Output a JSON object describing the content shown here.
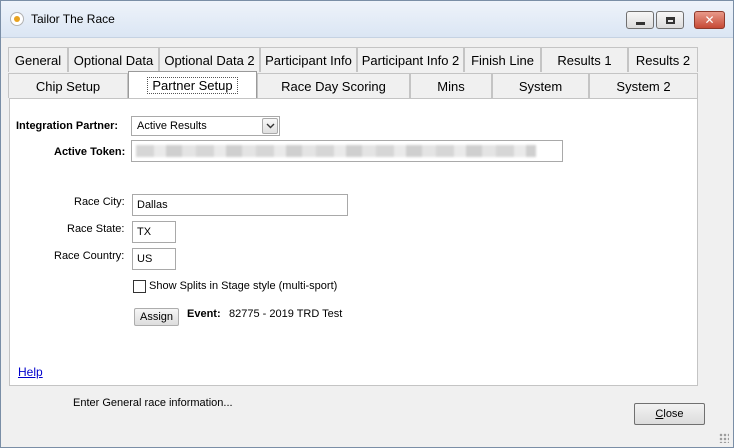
{
  "window": {
    "title": "Tailor The Race"
  },
  "tabs_row1": [
    {
      "label": "General"
    },
    {
      "label": "Optional Data"
    },
    {
      "label": "Optional Data 2"
    },
    {
      "label": "Participant Info"
    },
    {
      "label": "Participant Info 2"
    },
    {
      "label": "Finish Line"
    },
    {
      "label": "Results 1"
    },
    {
      "label": "Results 2"
    }
  ],
  "tabs_row2": [
    {
      "label": "Chip Setup"
    },
    {
      "label": "Partner Setup",
      "active": true
    },
    {
      "label": "Race Day Scoring"
    },
    {
      "label": "Mins"
    },
    {
      "label": "System"
    },
    {
      "label": "System 2"
    }
  ],
  "form": {
    "integration_partner_label": "Integration Partner:",
    "integration_partner_value": "Active Results",
    "active_token_label": "Active Token:",
    "race_city_label": "Race City:",
    "race_city_value": "Dallas",
    "race_state_label": "Race State:",
    "race_state_value": "TX",
    "race_country_label": "Race Country:",
    "race_country_value": "US",
    "show_splits_label": "Show Splits in Stage style (multi-sport)",
    "show_splits_checked": false,
    "assign_button": "Assign",
    "event_label": "Event:",
    "event_value": "82775 - 2019 TRD Test"
  },
  "footer": {
    "help_link": "Help",
    "status_text": "Enter General race information...",
    "close_button": "Close"
  }
}
